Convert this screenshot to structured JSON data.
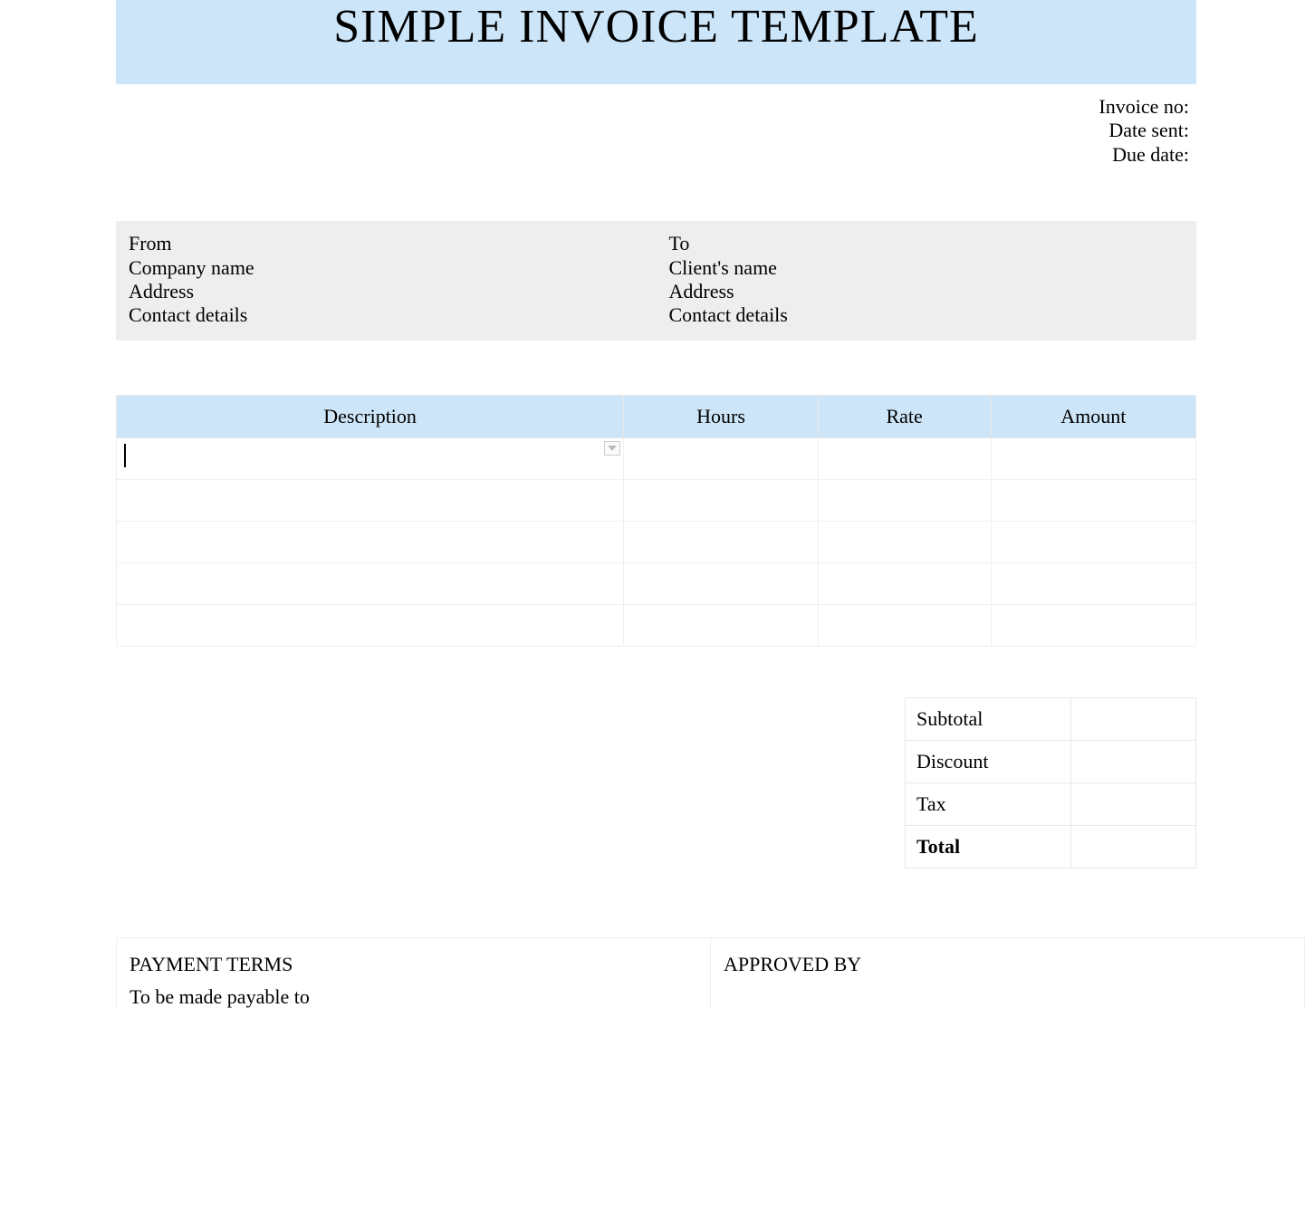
{
  "header": {
    "title": "SIMPLE INVOICE TEMPLATE"
  },
  "meta": {
    "invoice_no_label": "Invoice no:",
    "date_sent_label": "Date sent:",
    "due_date_label": "Due date:"
  },
  "from": {
    "heading": "From",
    "company": "Company name",
    "address": "Address",
    "contact": "Contact details"
  },
  "to": {
    "heading": "To",
    "client": "Client's name",
    "address": "Address",
    "contact": "Contact details"
  },
  "items_table": {
    "headers": {
      "description": "Description",
      "hours": "Hours",
      "rate": "Rate",
      "amount": "Amount"
    },
    "rows": [
      {
        "description": "",
        "hours": "",
        "rate": "",
        "amount": ""
      },
      {
        "description": "",
        "hours": "",
        "rate": "",
        "amount": ""
      },
      {
        "description": "",
        "hours": "",
        "rate": "",
        "amount": ""
      },
      {
        "description": "",
        "hours": "",
        "rate": "",
        "amount": ""
      },
      {
        "description": "",
        "hours": "",
        "rate": "",
        "amount": ""
      }
    ]
  },
  "totals": {
    "subtotal_label": "Subtotal",
    "subtotal_value": "",
    "discount_label": "Discount",
    "discount_value": "",
    "tax_label": "Tax",
    "tax_value": "",
    "total_label": "Total",
    "total_value": ""
  },
  "footer": {
    "payment_terms_heading": "PAYMENT TERMS",
    "payment_terms_sub": "To be made payable to",
    "approved_by_heading": "APPROVED BY"
  }
}
